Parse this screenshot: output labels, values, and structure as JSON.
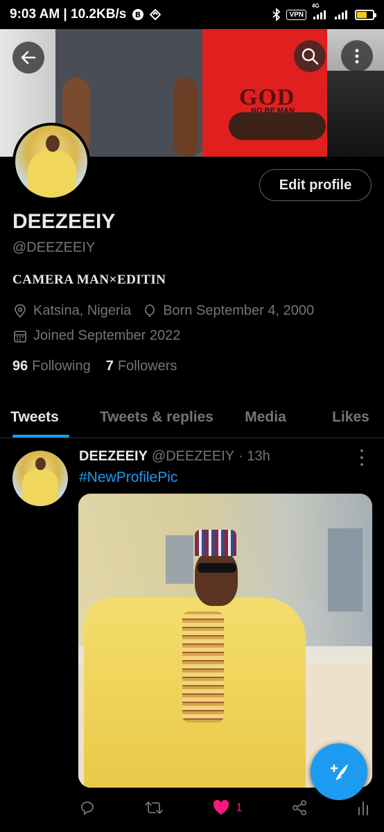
{
  "statusbar": {
    "time_speed": "9:03 AM | 10.2KB/s",
    "vpn": "VPN",
    "network": "4G"
  },
  "profile": {
    "name": "DEEZEEIY",
    "handle": "@DEEZEEIY",
    "bio": "CAMERA MAN×EDITIN",
    "location": "Katsina, Nigeria",
    "born": "Born September 4, 2000",
    "joined": "Joined September 2022",
    "following_count": "96",
    "following_label": "Following",
    "followers_count": "7",
    "followers_label": "Followers",
    "edit_label": "Edit profile"
  },
  "banner": {
    "shirt_text": "GOD",
    "shirt_subtext": "NO BE MAN"
  },
  "tabs": [
    {
      "label": "Tweets",
      "active": true
    },
    {
      "label": "Tweets & replies",
      "active": false
    },
    {
      "label": "Media",
      "active": false
    },
    {
      "label": "Likes",
      "active": false
    }
  ],
  "tweet": {
    "name": "DEEZEEIY",
    "handle": "@DEEZEEIY",
    "time": "· 13h",
    "text": "#NewProfilePic",
    "likes": "1"
  },
  "colors": {
    "accent": "#1d9bf0",
    "like": "#f91880",
    "muted": "#71767b",
    "text": "#e7e9ea",
    "background": "#000000"
  },
  "icons": [
    "back-arrow-icon",
    "search-icon",
    "more-vertical-icon",
    "location-icon",
    "balloon-icon",
    "calendar-icon",
    "reply-icon",
    "retweet-icon",
    "heart-icon",
    "share-icon",
    "analytics-icon",
    "compose-icon"
  ]
}
